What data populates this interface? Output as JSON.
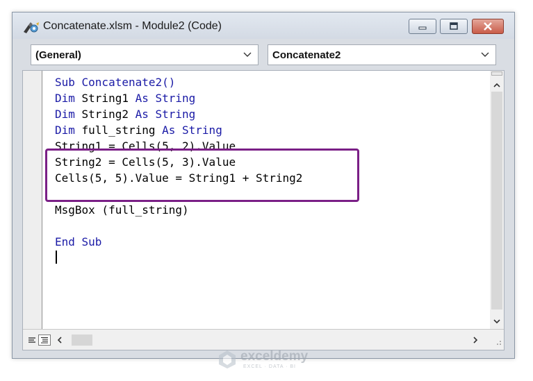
{
  "window": {
    "title": "Concatenate.xlsm - Module2 (Code)"
  },
  "toolbar": {
    "object_dropdown": "(General)",
    "procedure_dropdown": "Concatenate2"
  },
  "code": {
    "lines": [
      [
        {
          "t": "Sub ",
          "k": true
        },
        {
          "t": "Concatenate2()",
          "k": true
        }
      ],
      [
        {
          "t": "Dim ",
          "k": true
        },
        {
          "t": "String1 ",
          "k": false
        },
        {
          "t": "As String",
          "k": true
        }
      ],
      [
        {
          "t": "Dim ",
          "k": true
        },
        {
          "t": "String2 ",
          "k": false
        },
        {
          "t": "As String",
          "k": true
        }
      ],
      [
        {
          "t": "Dim ",
          "k": true
        },
        {
          "t": "full_string ",
          "k": false
        },
        {
          "t": "As String",
          "k": true
        }
      ],
      [
        {
          "t": "String1 = Cells(5, 2).Value",
          "k": false
        }
      ],
      [
        {
          "t": "String2 = Cells(5, 3).Value",
          "k": false
        }
      ],
      [
        {
          "t": "Cells(5, 5).Value = String1 + String2",
          "k": false
        }
      ],
      [
        {
          "t": "",
          "k": false
        }
      ],
      [
        {
          "t": "MsgBox (full_string)",
          "k": false
        }
      ],
      [
        {
          "t": "",
          "k": false
        }
      ],
      [
        {
          "t": "End Sub",
          "k": true
        }
      ]
    ]
  },
  "colors": {
    "keyword": "#1a1aa6",
    "highlight_box": "#7a1f86"
  },
  "watermark": {
    "name": "exceldemy",
    "tagline": "EXCEL · DATA · BI"
  }
}
